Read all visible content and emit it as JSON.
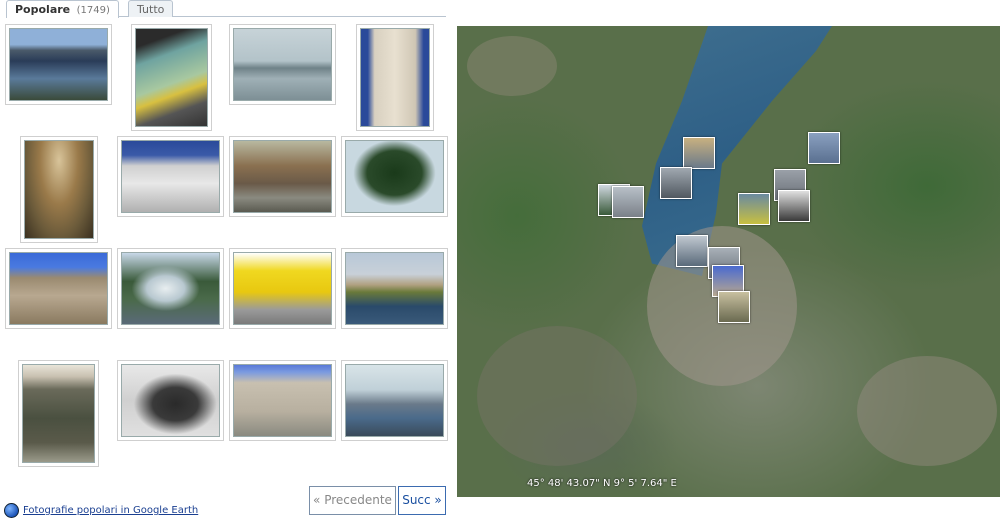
{
  "tabs": {
    "popular_label": "Popolare",
    "popular_count": "(1749)",
    "all_label": "Tutto"
  },
  "photos": [
    {
      "name": "lake-view-mountains"
    },
    {
      "name": "funicular-interior"
    },
    {
      "name": "lake-misty"
    },
    {
      "name": "cathedral-facade"
    },
    {
      "name": "dome-interior"
    },
    {
      "name": "cathedral-side"
    },
    {
      "name": "rainy-square"
    },
    {
      "name": "cedar-tree"
    },
    {
      "name": "church-tower"
    },
    {
      "name": "lake-fountain"
    },
    {
      "name": "yellow-funicular"
    },
    {
      "name": "lakeside-villa"
    },
    {
      "name": "hills-sunset"
    },
    {
      "name": "gear-sculpture"
    },
    {
      "name": "piazza-buildings"
    },
    {
      "name": "lake-promenade"
    }
  ],
  "pager": {
    "prev_label": "« Precedente",
    "next_label": "Succ »"
  },
  "footer": {
    "google_earth_link": "Fotografie popolari in Google Earth"
  },
  "map": {
    "coordinates": "45° 48' 43.07\" N 9° 5' 7.64\" E"
  }
}
